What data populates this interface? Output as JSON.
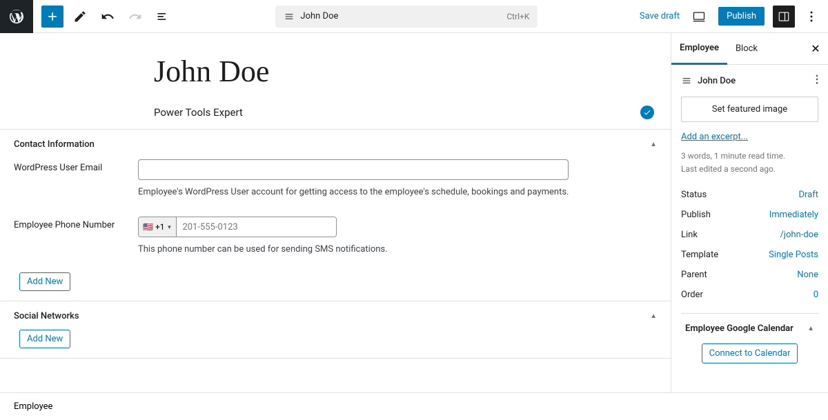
{
  "toolbar": {
    "doc_label": "John Doe",
    "shortcut": "Ctrl+K",
    "save_draft": "Save draft",
    "publish": "Publish"
  },
  "page": {
    "title": "John Doe",
    "subtitle": "Power Tools Expert"
  },
  "sections": {
    "contact": {
      "title": "Contact Information",
      "email_label": "WordPress User Email",
      "email_help": "Employee's WordPress User account for getting access to the employee's schedule, bookings and payments.",
      "phone_label": "Employee Phone Number",
      "phone_code": "+1",
      "phone_placeholder": "201-555-0123",
      "phone_help": "This phone number can be used for sending SMS notifications.",
      "add_new": "Add New"
    },
    "social": {
      "title": "Social Networks",
      "add_new": "Add New"
    }
  },
  "panel": {
    "tabs": {
      "employee": "Employee",
      "block": "Block"
    },
    "doc_name": "John Doe",
    "featured_image": "Set featured image",
    "excerpt_link": "Add an excerpt...",
    "meta_line1": "3 words, 1 minute read time.",
    "meta_line2": "Last edited a second ago.",
    "props": {
      "status": {
        "label": "Status",
        "value": "Draft"
      },
      "publish": {
        "label": "Publish",
        "value": "Immediately"
      },
      "link": {
        "label": "Link",
        "value": "/john-doe"
      },
      "template": {
        "label": "Template",
        "value": "Single Posts"
      },
      "parent": {
        "label": "Parent",
        "value": "None"
      },
      "order": {
        "label": "Order",
        "value": "0"
      }
    },
    "calendar": {
      "title": "Employee Google Calendar",
      "connect": "Connect to Calendar"
    }
  },
  "footer": {
    "breadcrumb": "Employee"
  }
}
